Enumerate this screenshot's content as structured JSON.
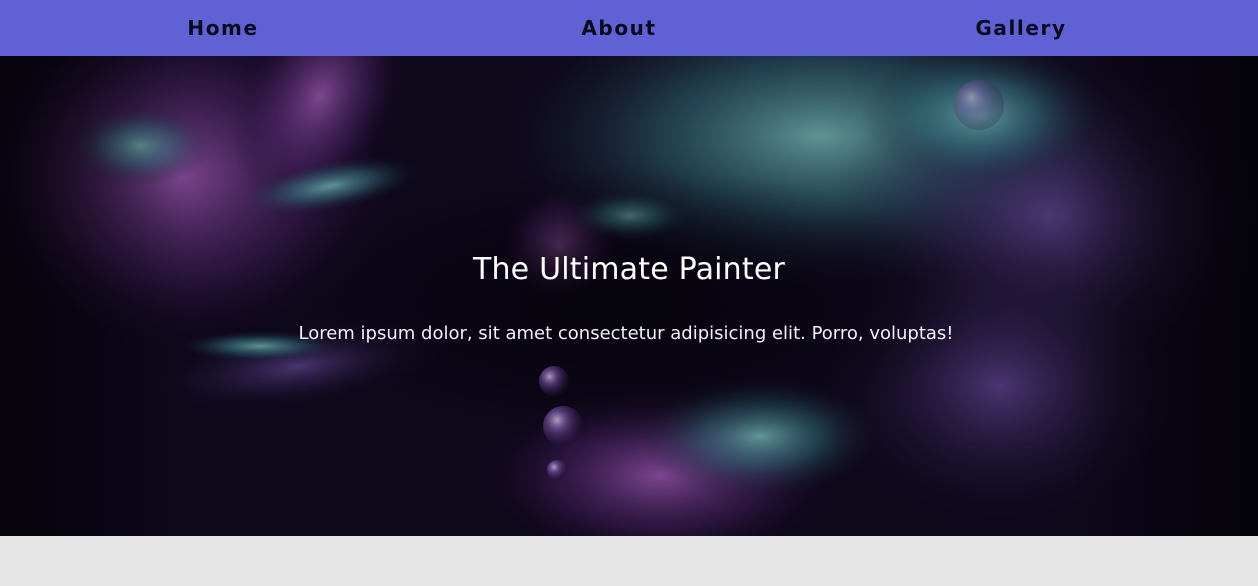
{
  "nav": {
    "items": [
      {
        "label": "Home"
      },
      {
        "label": "About"
      },
      {
        "label": "Gallery"
      }
    ]
  },
  "hero": {
    "title": "The Ultimate Painter",
    "text": "Lorem ipsum dolor, sit amet consectetur adipisicing elit. Porro, voluptas!"
  },
  "colors": {
    "nav_background": "#6161d6",
    "nav_text": "#0b0b1e",
    "hero_text": "#ffffff",
    "page_background": "#e6e6e6"
  }
}
